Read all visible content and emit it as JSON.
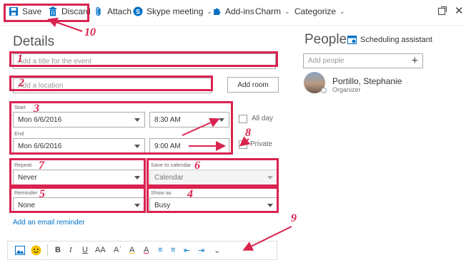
{
  "toolbar": {
    "save_label": "Save",
    "discard_label": "Discard",
    "attach_label": "Attach",
    "skype_label": "Skype meeting",
    "addins_label": "Add-ins",
    "charm_label": "Charm",
    "categorize_label": "Categorize"
  },
  "details": {
    "title": "Details",
    "title_placeholder": "Add a title for the event",
    "location_placeholder": "Add a location",
    "add_room_label": "Add room",
    "start_label": "Start",
    "start_date": "Mon 6/6/2016",
    "start_time": "8:30 AM",
    "end_label": "End",
    "end_date": "Mon 6/6/2016",
    "end_time": "9:00 AM",
    "all_day_label": "All day",
    "private_label": "Private",
    "repeat_label": "Repeat",
    "repeat_value": "Never",
    "save_to_calendar_label": "Save to calendar",
    "save_to_calendar_value": "Calendar",
    "reminder_label": "Reminder",
    "reminder_value": "None",
    "show_as_label": "Show as",
    "show_as_value": "Busy",
    "email_reminder_link": "Add an email reminder"
  },
  "people": {
    "title": "People",
    "scheduling_label": "Scheduling assistant",
    "add_people_placeholder": "Add people",
    "organizer_name": "Portillo, Stephanie",
    "organizer_role": "Organizer"
  },
  "annotations": {
    "n1": "1",
    "n2": "2",
    "n3": "3",
    "n4": "4",
    "n5": "5",
    "n6": "6",
    "n7": "7",
    "n8": "8",
    "n9": "9",
    "n10": "10"
  },
  "colors": {
    "accent": "#0072c6",
    "annotation": "#d9234f"
  }
}
